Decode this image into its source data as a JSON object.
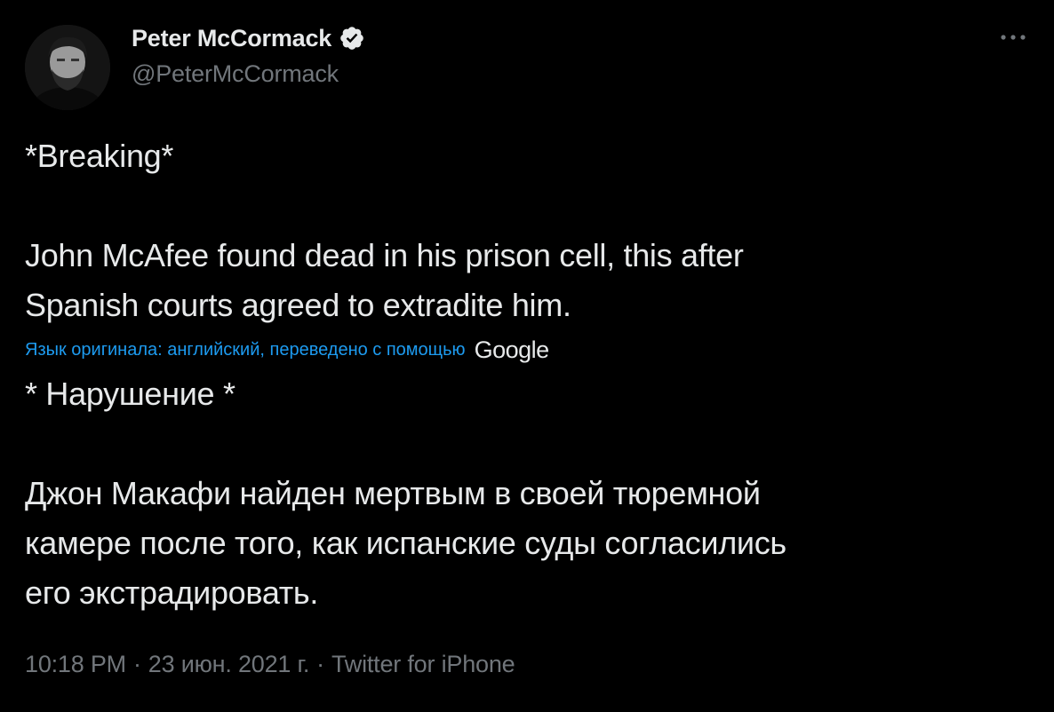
{
  "author": {
    "name": "Peter McCormack",
    "handle": "@PeterMcCormack",
    "verified": true
  },
  "tweet": {
    "original_text": "*Breaking*\n\nJohn McAfee found dead in his prison cell, this after\nSpanish courts agreed to extradite him.",
    "translation_note": "Язык оригинала: английский, переведено с помощью",
    "translation_provider": "Google",
    "translated_text": "* Нарушение *\n\n Джон Макафи найден мертвым в своей тюремной\nкамере после того, как испанские суды согласились\nего экстрадировать.",
    "time": "10:18 PM",
    "date": "23 июн. 2021 г.",
    "source": "Twitter for iPhone",
    "separator": "·"
  },
  "icons": {
    "verified": "verified-badge-icon",
    "more": "more-options-icon"
  },
  "colors": {
    "background": "#000000",
    "primary_text": "#e7e9ea",
    "secondary_text": "#71767b",
    "link": "#1d9bf0"
  }
}
